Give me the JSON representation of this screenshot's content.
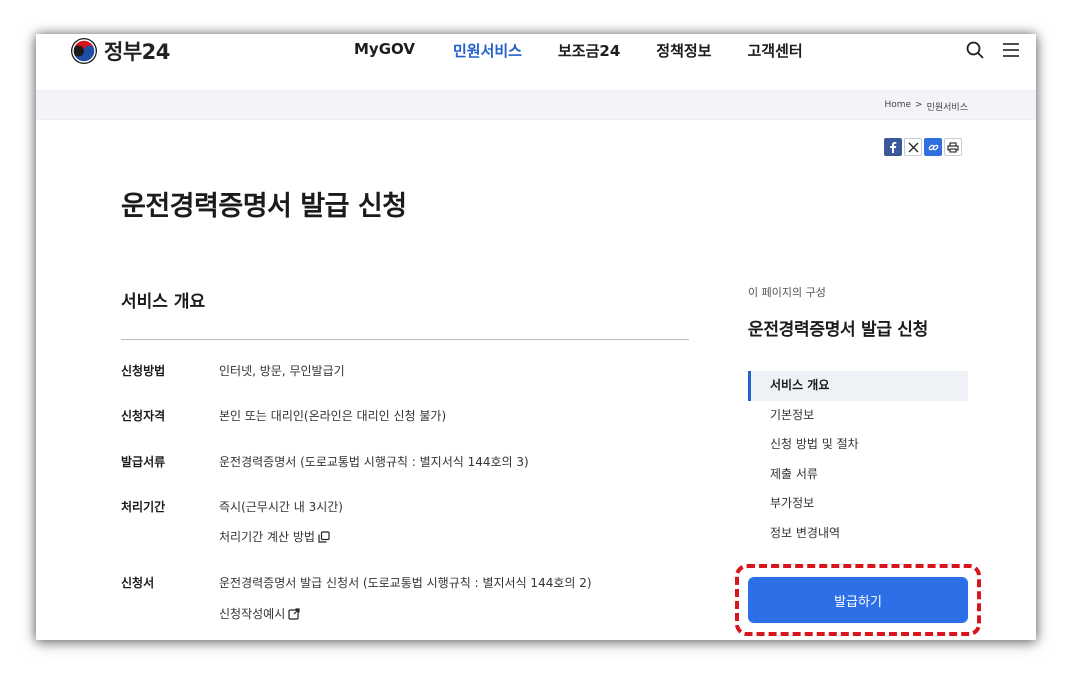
{
  "header": {
    "logo_text": "정부24",
    "nav": [
      "MyGOV",
      "민원서비스",
      "보조금24",
      "정책정보",
      "고객센터"
    ],
    "active_nav": "민원서비스",
    "search_icon": "search-icon",
    "menu_icon": "hamburger-menu-icon"
  },
  "breadcrumb": {
    "home": "Home",
    "separator": ">",
    "current": "민원서비스"
  },
  "share": {
    "icons": [
      "facebook-icon",
      "x-icon",
      "link-icon",
      "print-icon"
    ]
  },
  "page": {
    "title": "운전경력증명서 발급 신청",
    "section_title": "서비스 개요"
  },
  "overview": {
    "rows": [
      {
        "label": "신청방법",
        "value": "인터넷, 방문, 무인발급기"
      },
      {
        "label": "신청자격",
        "value": "본인 또는 대리인(온라인은 대리인 신청 불가)"
      },
      {
        "label": "발급서류",
        "value": "운전경력증명서 (도로교통법 시행규칙 : 별지서식 144호의 3)"
      },
      {
        "label": "처리기간",
        "value": "즉시(근무시간 내 3시간)",
        "link": "처리기간 계산 방법"
      },
      {
        "label": "신청서",
        "value": "운전경력증명서 발급 신청서 (도로교통법 시행규칙 : 별지서식 144호의 2)",
        "link": "신청작성예시"
      }
    ]
  },
  "toc": {
    "caption": "이 페이지의 구성",
    "title": "운전경력증명서 발급 신청",
    "items": [
      "서비스 개요",
      "기본정보",
      "신청 방법 및 절차",
      "제출 서류",
      "부가정보",
      "정보 변경내역"
    ],
    "active": "서비스 개요"
  },
  "actions": {
    "apply_label": "발급하기"
  },
  "colors": {
    "accent": "#2362c9",
    "button": "#2d6fe6",
    "highlight": "#d8141c"
  }
}
